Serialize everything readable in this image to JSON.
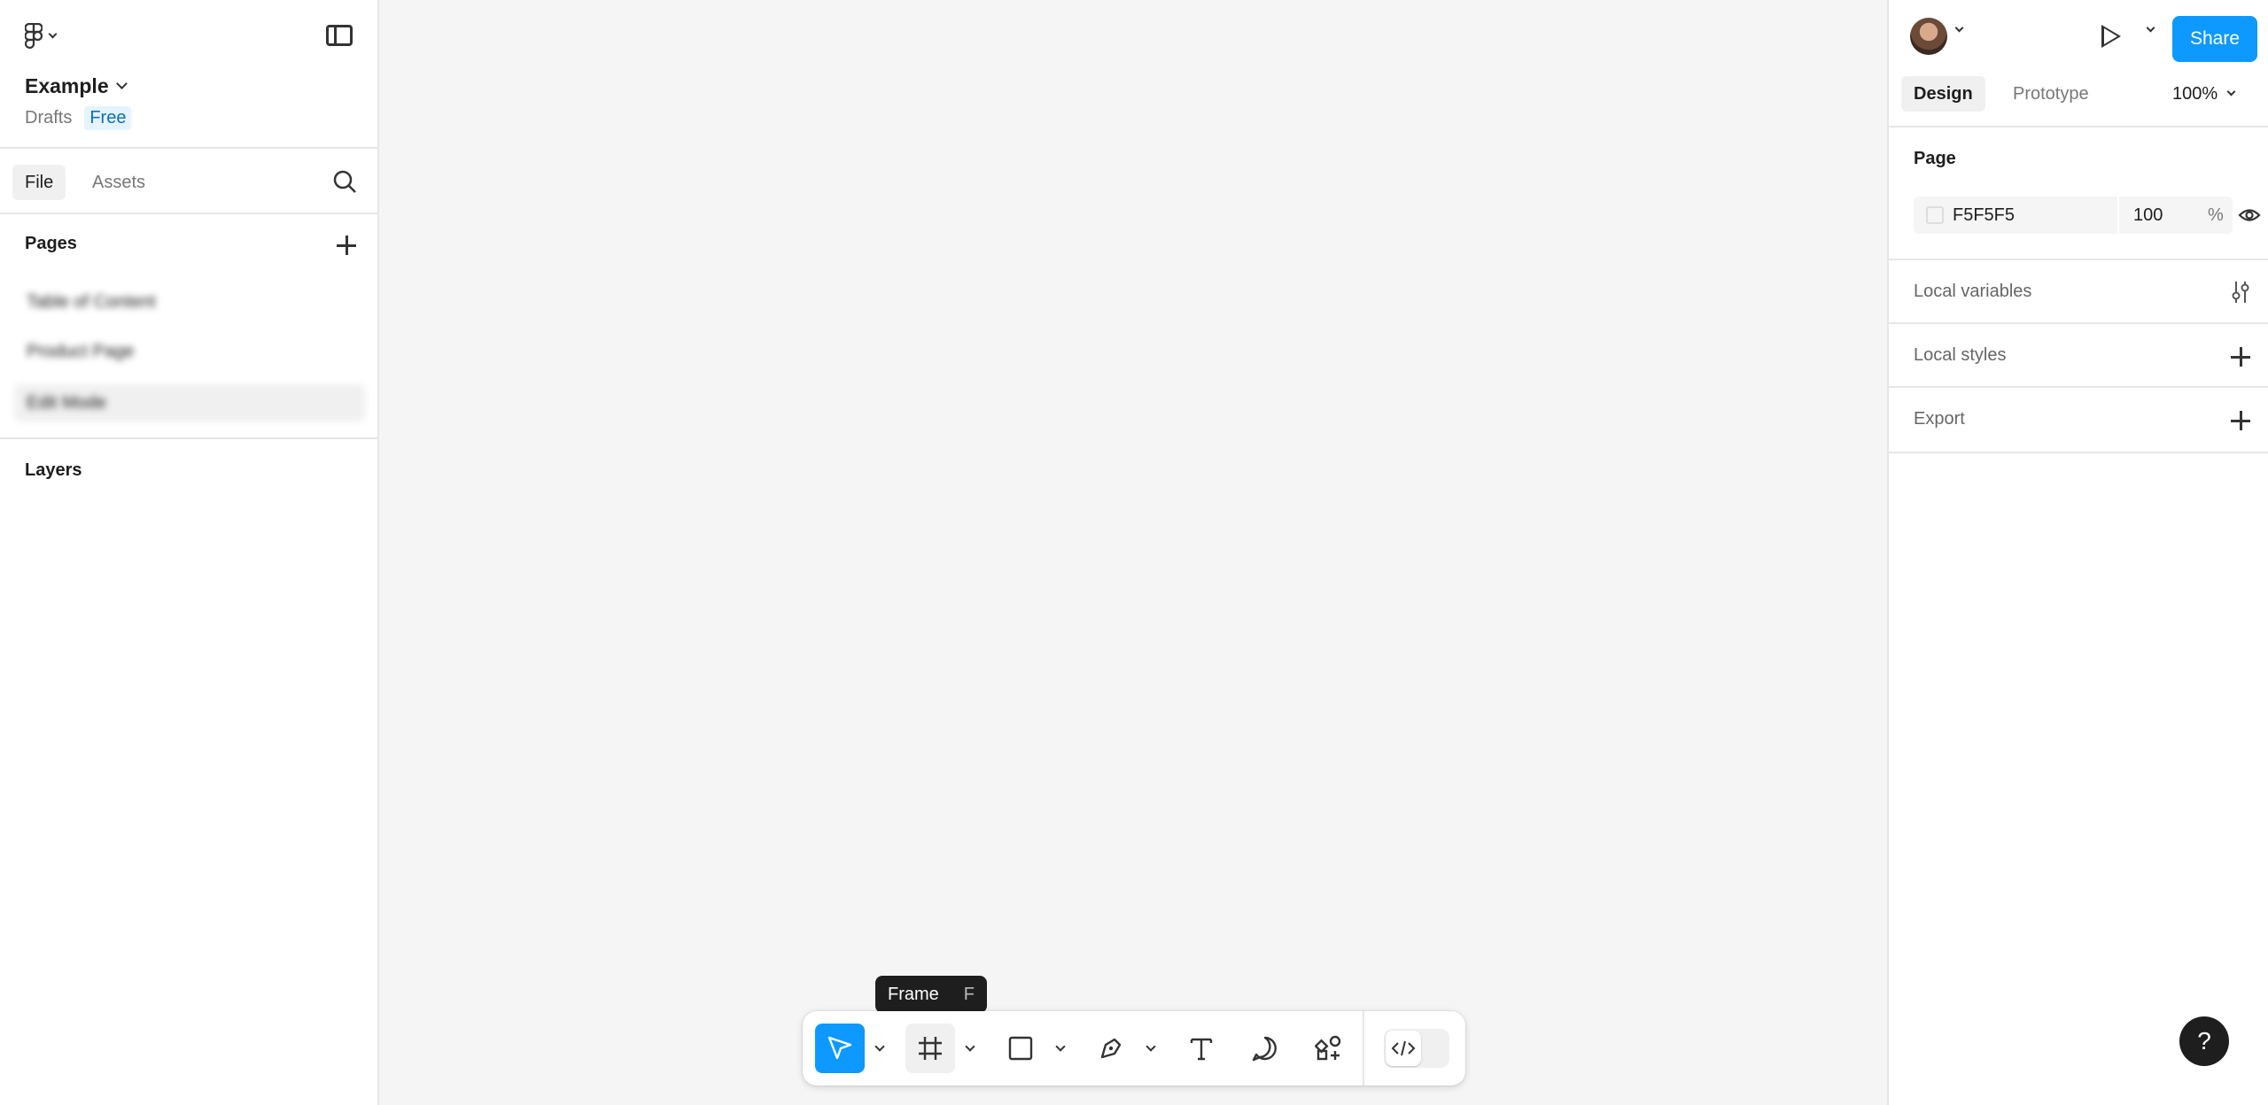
{
  "file": {
    "title": "Example",
    "location": "Drafts",
    "plan_badge": "Free"
  },
  "left_tabs": [
    "File",
    "Assets"
  ],
  "pages": {
    "heading": "Pages",
    "items": [
      "Table of Content",
      "Product Page",
      "Edit Mode"
    ],
    "selected_index": 2
  },
  "layers": {
    "heading": "Layers"
  },
  "right": {
    "share_label": "Share",
    "tabs": [
      "Design",
      "Prototype"
    ],
    "zoom": "100%",
    "page_heading": "Page",
    "page_color": "F5F5F5",
    "page_opacity": "100",
    "opacity_unit": "%",
    "local_variables": "Local variables",
    "local_styles": "Local styles",
    "export": "Export"
  },
  "tooltip": {
    "label": "Frame",
    "shortcut": "F"
  },
  "help_label": "?",
  "colors": {
    "accent": "#0d99ff",
    "canvas": "#f5f5f5",
    "tooltip_bg": "#1e1e1e"
  },
  "icons": {
    "logo": "figma-logo-icon",
    "sidebar_toggle": "sidebar-toggle-icon",
    "search": "search-icon",
    "add_page": "plus-icon",
    "play": "play-icon",
    "visibility": "eye-icon",
    "variables": "variables-icon",
    "tools": [
      "move-icon",
      "frame-icon",
      "rectangle-icon",
      "pen-icon",
      "text-icon",
      "comment-icon",
      "actions-icon",
      "dev-mode-icon"
    ]
  }
}
